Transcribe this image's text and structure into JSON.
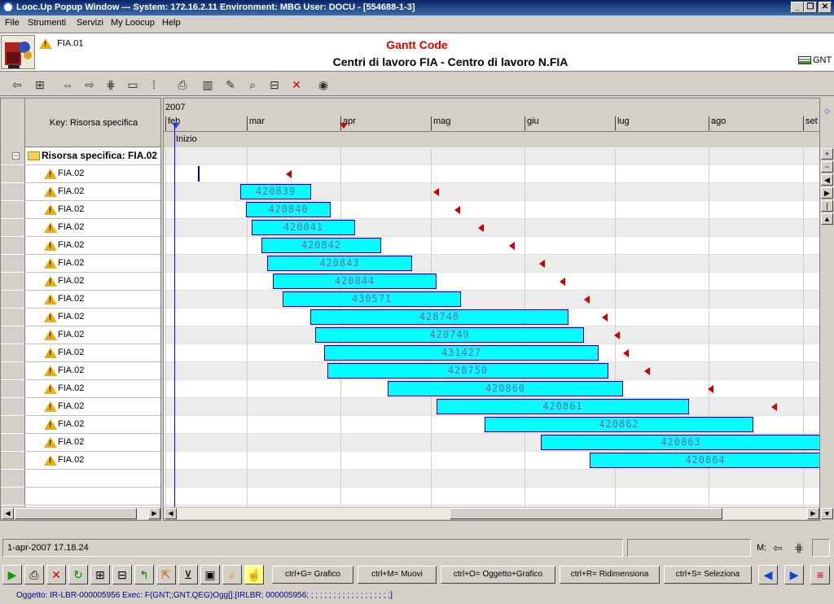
{
  "window": {
    "title": "Looc.Up Popup Window  ---  System: 172.16.2.11 Environment: MBG User: DOCU - [554688-1-3]",
    "controls": [
      "_",
      "❐",
      "✕"
    ]
  },
  "menu": [
    "File",
    "Strumenti",
    "Servizi",
    "My Loocup",
    "Help"
  ],
  "header": {
    "code": "FIA.01",
    "title": "Gantt Code",
    "subtitle": "Centri di lavoro FIA - Centro di lavoro N.FIA",
    "gnt_label": "GNT"
  },
  "left": {
    "key_header": "Key: Risorsa specifica",
    "group_label": "Risorsa specifica: FIA.02",
    "row_label": "FIA.02",
    "row_count": 17
  },
  "gantt": {
    "year": "2007",
    "months": [
      "feb",
      "mar",
      "apr",
      "mag",
      "giu",
      "lug",
      "ago",
      "set"
    ],
    "start_label": "Inizio",
    "bars": [
      "",
      "420839",
      "420840",
      "420841",
      "420842",
      "420843",
      "420844",
      "430571",
      "428748",
      "428749",
      "431427",
      "428750",
      "420860",
      "420861",
      "420862",
      "420863",
      "420864"
    ]
  },
  "status": {
    "datetime": "1-apr-2007 17.18.24",
    "mode_label": "M:"
  },
  "shortcuts": [
    "ctrl+G= Grafico",
    "ctrl+M= Muovi",
    "ctrl+O= Oggetto+Grafico",
    "ctrl+R= Ridimensiona",
    "ctrl+S= Seleziona"
  ],
  "footer": "Oggetto: IR-LBR-000005956 Exec: F(GNT;;GNT.QEG)Ogg[];[IRLBR; 000005956; ; ; ; ; ; ; ; ; ; ; ; ; ; ; ; ; ; ;]"
}
